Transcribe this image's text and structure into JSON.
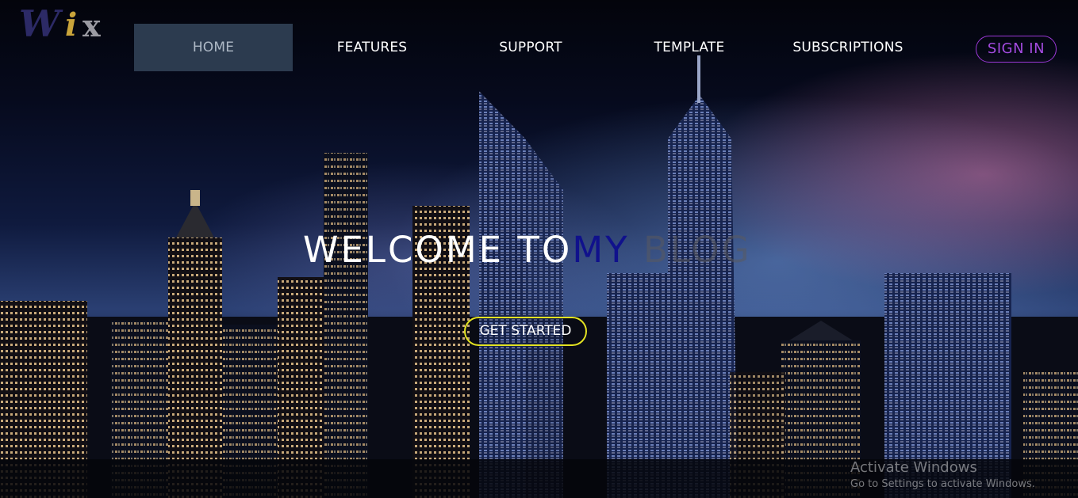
{
  "logo": {
    "letter_w": "W",
    "letter_i": "i",
    "letter_x": "x"
  },
  "nav": {
    "items": [
      {
        "label": "HOME",
        "active": true
      },
      {
        "label": "FEATURES",
        "active": false
      },
      {
        "label": "SUPPORT",
        "active": false
      },
      {
        "label": "TEMPLATE",
        "active": false
      },
      {
        "label": "SUBSCRIPTIONS",
        "active": false
      }
    ],
    "signin_label": "SIGN IN"
  },
  "hero": {
    "headline_part1": "WELCOME TO",
    "headline_part2": "MY",
    "headline_part3": " BLOG",
    "cta_label": "GET STARTED"
  },
  "watermark": {
    "title": "Activate Windows",
    "subtitle": "Go to Settings to activate Windows."
  },
  "colors": {
    "nav_active_bg": "#2c3b4f",
    "signin_border": "#9b38d6",
    "cta_border": "#e3e222",
    "headline_accent": "#10118c"
  }
}
